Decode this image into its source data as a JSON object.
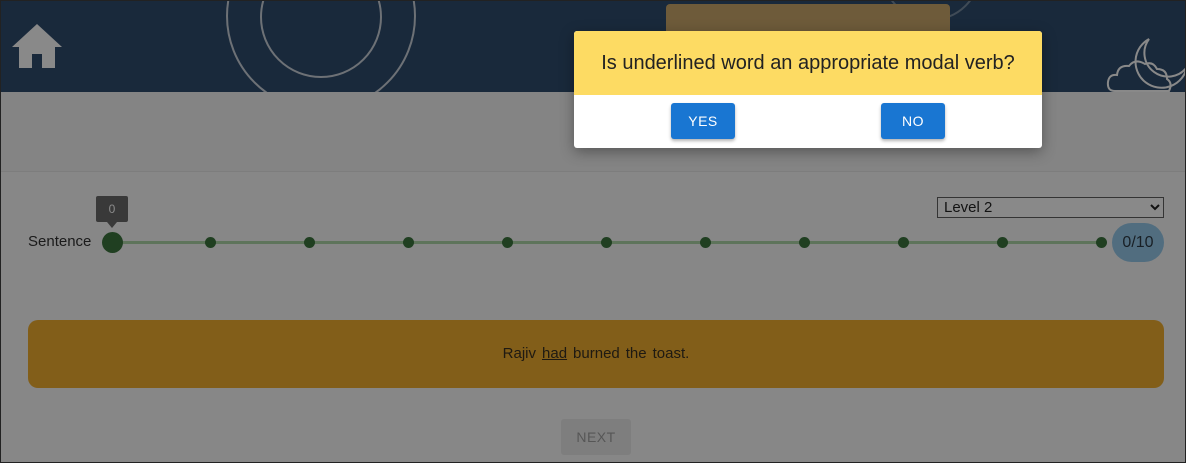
{
  "header": {
    "home_icon": "home-icon",
    "decoration_icon": "cloud-moon-icon"
  },
  "progress": {
    "label": "Sentence",
    "current_value": "0",
    "score": "0/10",
    "answered": 0,
    "total": 10
  },
  "level_select": {
    "selected": "Level 2"
  },
  "sentence": {
    "words": [
      "Rajiv",
      "had",
      "burned",
      "the",
      "toast."
    ],
    "underlined_word": "had"
  },
  "next_button": {
    "label": "NEXT"
  },
  "dialog": {
    "question": "Is underlined word an appropriate modal verb?",
    "yes_label": "YES",
    "no_label": "NO"
  },
  "colors": {
    "header_bg": "#1f3f63",
    "dialog_question_bg": "#fddb63",
    "button_primary": "#1976d2",
    "card_bg": "#f1a81f",
    "slider_dot": "#2c6a2e",
    "score_bg": "#8fc6ea"
  }
}
